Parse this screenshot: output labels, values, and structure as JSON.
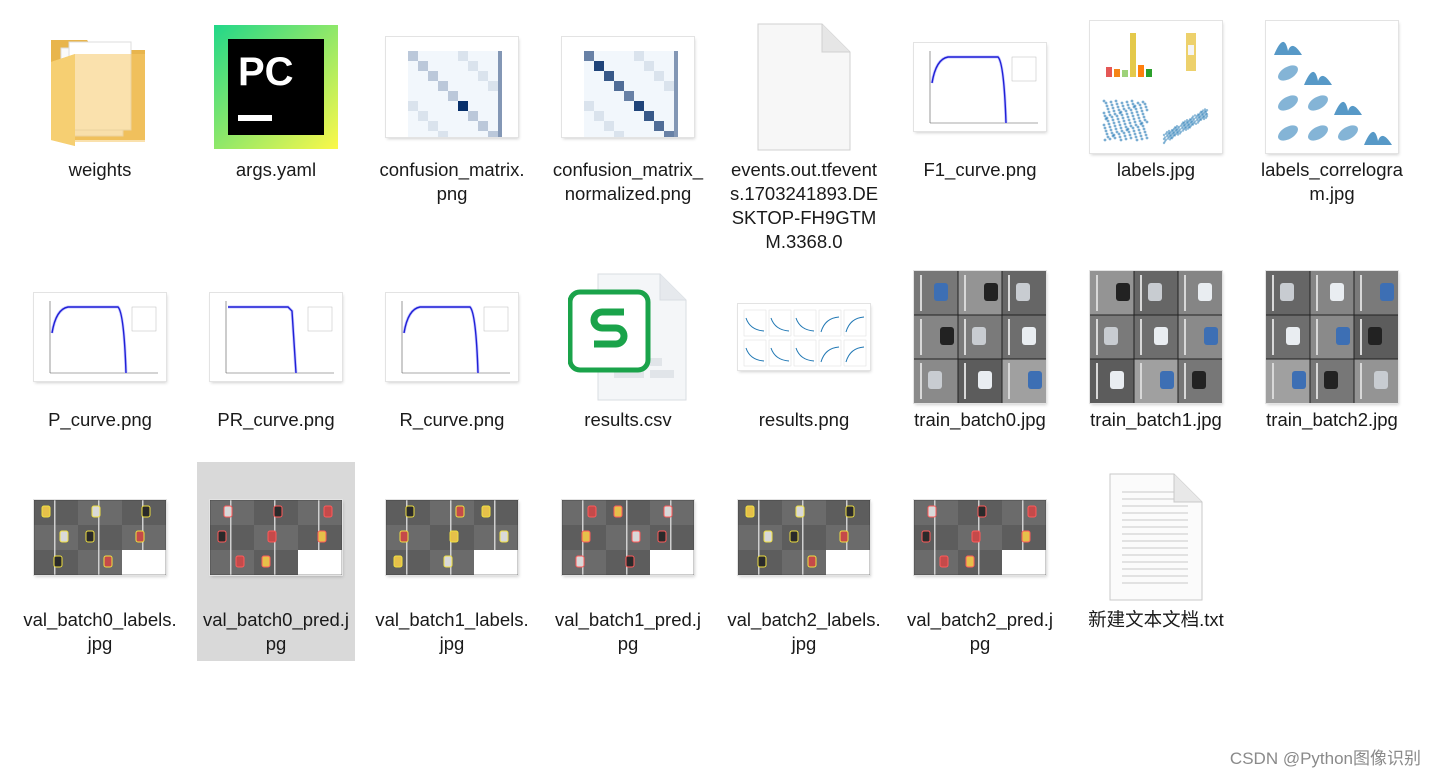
{
  "files": [
    {
      "name": "weights",
      "type": "folder",
      "icon": "folder-icon"
    },
    {
      "name": "args.yaml",
      "type": "pycharm",
      "icon": "pycharm-icon",
      "icon_text": "PC"
    },
    {
      "name": "confusion_matrix.png",
      "type": "matrix",
      "icon": "confusion-matrix-thumbnail"
    },
    {
      "name": "confusion_matrix_normalized.png",
      "type": "matrix-norm",
      "icon": "confusion-matrix-normalized-thumbnail"
    },
    {
      "name": "events.out.tfevents.1703241893.DESKTOP-FH9GTMM.3368.0",
      "type": "blank",
      "icon": "blank-file-icon"
    },
    {
      "name": "F1_curve.png",
      "type": "curve",
      "icon": "f1-curve-thumbnail"
    },
    {
      "name": "labels.jpg",
      "type": "labels",
      "icon": "labels-thumbnail"
    },
    {
      "name": "labels_correlogram.jpg",
      "type": "correlogram",
      "icon": "correlogram-thumbnail"
    },
    {
      "name": "P_curve.png",
      "type": "curve",
      "icon": "p-curve-thumbnail"
    },
    {
      "name": "PR_curve.png",
      "type": "pr",
      "icon": "pr-curve-thumbnail"
    },
    {
      "name": "R_curve.png",
      "type": "curve",
      "icon": "r-curve-thumbnail"
    },
    {
      "name": "results.csv",
      "type": "csv",
      "icon": "spreadsheet-icon"
    },
    {
      "name": "results.png",
      "type": "results",
      "icon": "results-thumbnail"
    },
    {
      "name": "train_batch0.jpg",
      "type": "train",
      "icon": "train-batch-thumbnail"
    },
    {
      "name": "train_batch1.jpg",
      "type": "train",
      "icon": "train-batch-thumbnail"
    },
    {
      "name": "train_batch2.jpg",
      "type": "train",
      "icon": "train-batch-thumbnail"
    },
    {
      "name": "val_batch0_labels.jpg",
      "type": "val",
      "icon": "val-batch-thumbnail"
    },
    {
      "name": "val_batch0_pred.jpg",
      "type": "val",
      "icon": "val-batch-thumbnail",
      "selected": true
    },
    {
      "name": "val_batch1_labels.jpg",
      "type": "val",
      "icon": "val-batch-thumbnail"
    },
    {
      "name": "val_batch1_pred.jpg",
      "type": "val",
      "icon": "val-batch-thumbnail"
    },
    {
      "name": "val_batch2_labels.jpg",
      "type": "val",
      "icon": "val-batch-thumbnail"
    },
    {
      "name": "val_batch2_pred.jpg",
      "type": "val",
      "icon": "val-batch-thumbnail"
    },
    {
      "name": "新建文本文档.txt",
      "type": "txt",
      "icon": "text-file-icon"
    }
  ],
  "watermark": "CSDN @Python图像识别",
  "colors": {
    "folder": "#f5c86a",
    "pycharm_green": "#21d789",
    "pycharm_yellow": "#fcf84a",
    "csv_green": "#1aa34a",
    "matrix_blue": "#08306b",
    "selection": "#d9d9d9"
  }
}
